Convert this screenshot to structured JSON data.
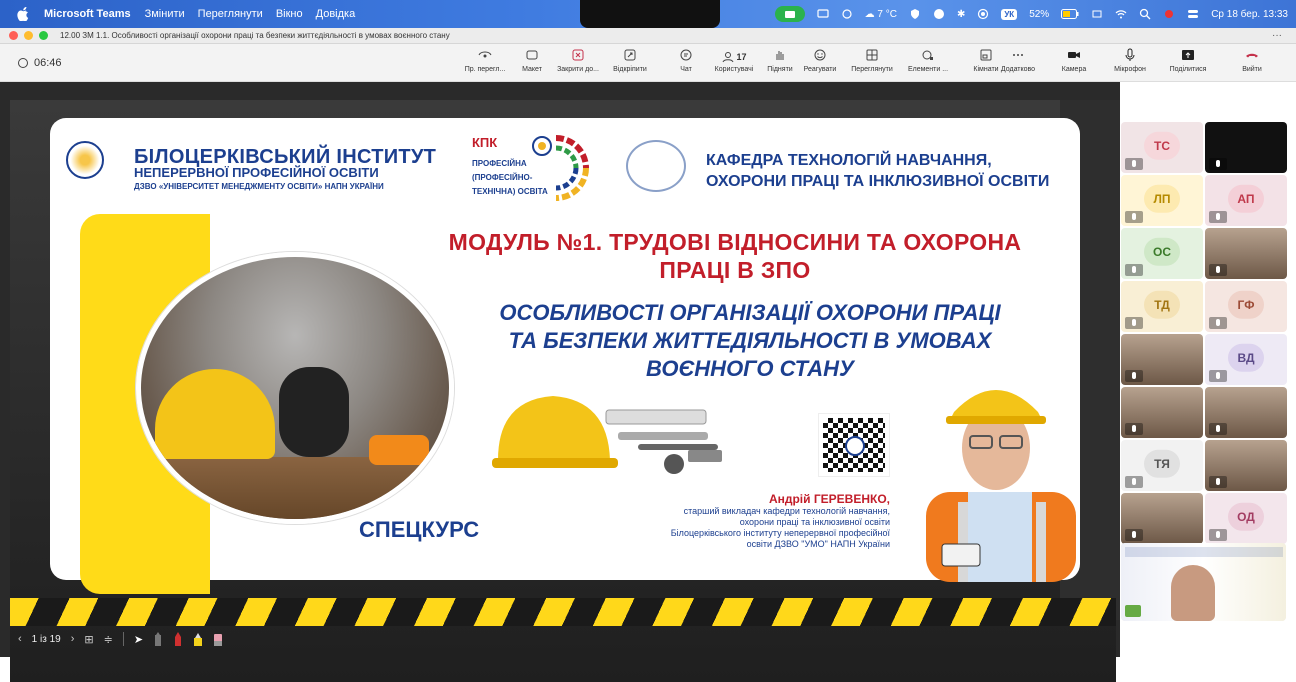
{
  "menubar": {
    "app_name": "Microsoft Teams",
    "items": [
      "Змінити",
      "Переглянути",
      "Вікно",
      "Довідка"
    ],
    "weather": "7 °C",
    "keyboard_layout": "УК",
    "battery": "52%",
    "datetime": "Ср 18 бер.  13:33"
  },
  "window": {
    "title": "12.00 ЗМ 1.1. Особливості організації охорони праці та безпеки життєдіяльності в умовах воєнного стану",
    "more": "···"
  },
  "toolbar": {
    "timer": "06:46",
    "buttons": [
      {
        "label": "Пр. перегл...",
        "icon": "eye-icon"
      },
      {
        "label": "Макет",
        "icon": "layout-icon"
      },
      {
        "label": "Закрити до...",
        "icon": "close-box-icon"
      },
      {
        "label": "Відкріпити",
        "icon": "unpin-icon"
      },
      {
        "label": "Чат",
        "icon": "chat-icon"
      },
      {
        "label": "Користувачі",
        "icon": "people-icon",
        "count": "17"
      },
      {
        "label": "Підняти",
        "icon": "hand-icon"
      },
      {
        "label": "Реагувати",
        "icon": "smile-icon"
      },
      {
        "label": "Переглянути",
        "icon": "grid-icon"
      },
      {
        "label": "Елементи ...",
        "icon": "apps-icon"
      },
      {
        "label": "Кімнати",
        "icon": "rooms-icon"
      },
      {
        "label": "Додатково",
        "icon": "more-icon"
      },
      {
        "label": "Камера",
        "icon": "camera-icon"
      },
      {
        "label": "Мікрофон",
        "icon": "mic-icon"
      },
      {
        "label": "Поділитися",
        "icon": "share-icon"
      },
      {
        "label": "Вийти",
        "icon": "leave-icon"
      }
    ]
  },
  "slide": {
    "inst_title": "БІЛОЦЕРКІВСЬКИЙ ІНСТИТУТ",
    "inst_sub1": "НЕПЕРЕРВНОЇ ПРОФЕСІЙНОЇ ОСВІТИ",
    "inst_sub2": "ДЗВО «УНІВЕРСИТЕТ МЕНЕДЖМЕНТУ ОСВІТИ» НАПН УКРАЇНИ",
    "kpk_word": "КПК",
    "kpk_line1": "ПРОФЕСІЙНА",
    "kpk_line2": "(ПРОФЕСІЙНО-",
    "kpk_line3": "ТЕХНІЧНА) ОСВІТА",
    "dept_line1": "КАФЕДРА ТЕХНОЛОГІЙ НАВЧАННЯ,",
    "dept_line2": "ОХОРОНИ ПРАЦІ ТА ІНКЛЮЗИВНОЇ ОСВІТИ",
    "module_line1": "МОДУЛЬ №1. ТРУДОВІ ВІДНОСИНИ ТА ОХОРОНА",
    "module_line2": "ПРАЦІ В ЗПО",
    "topic_line1": "ОСОБЛИВОСТІ ОРГАНІЗАЦІЇ ОХОРОНИ ПРАЦІ",
    "topic_line2": "ТА БЕЗПЕКИ ЖИТТЕДІЯЛЬНОСТІ В УМОВАХ",
    "topic_line3": "ВОЄННОГО СТАНУ",
    "course_label": "СПЕЦКУРС",
    "author_name": "Андрій ГЕРЕВЕНКО,",
    "author_bio1": "старший викладач кафедри технологій навчання,",
    "author_bio2": "охорони праці та інклюзивної освіти",
    "author_bio3": "Білоцерківського інституту неперервної професійної",
    "author_bio4": "освіти ДЗВО \"УМО\" НАПН України"
  },
  "participants": [
    {
      "initials": "ТС",
      "bg": "#f1e4e6",
      "fg": "#c0394b",
      "chip": "#f6d7db"
    },
    {
      "initials": "",
      "bg": "#111111",
      "fg": "#fff",
      "chip": "#111111",
      "dark": true
    },
    {
      "initials": "ЛП",
      "bg": "#fff5d6",
      "fg": "#b58a00",
      "chip": "#fdeab0"
    },
    {
      "initials": "АП",
      "bg": "#f3e2e7",
      "fg": "#c0394b",
      "chip": "#f4cfd7"
    },
    {
      "initials": "ОС",
      "bg": "#e4f2e0",
      "fg": "#3b7a2a",
      "chip": "#cfe8c7"
    },
    {
      "initials": "",
      "video": true
    },
    {
      "initials": "ТД",
      "bg": "#f9efd5",
      "fg": "#a27512",
      "chip": "#f4e2b6"
    },
    {
      "initials": "ГФ",
      "bg": "#f5e6e1",
      "fg": "#9c4b36",
      "chip": "#efd2c9"
    },
    {
      "initials": "",
      "video": true
    },
    {
      "initials": "ВД",
      "bg": "#eeeaf5",
      "fg": "#5b4a88",
      "chip": "#dcd3ee"
    },
    {
      "initials": "",
      "video": true
    },
    {
      "initials": "",
      "video": true
    },
    {
      "initials": "ТЯ",
      "bg": "#f2f2f2",
      "fg": "#555555",
      "chip": "#e1e1e1"
    },
    {
      "initials": "",
      "video": true
    },
    {
      "initials": "",
      "video": true
    },
    {
      "initials": "ОД",
      "bg": "#f3e6ec",
      "fg": "#a33c62",
      "chip": "#edd0dc"
    }
  ],
  "slidenav": {
    "counter": "1 із 19"
  }
}
